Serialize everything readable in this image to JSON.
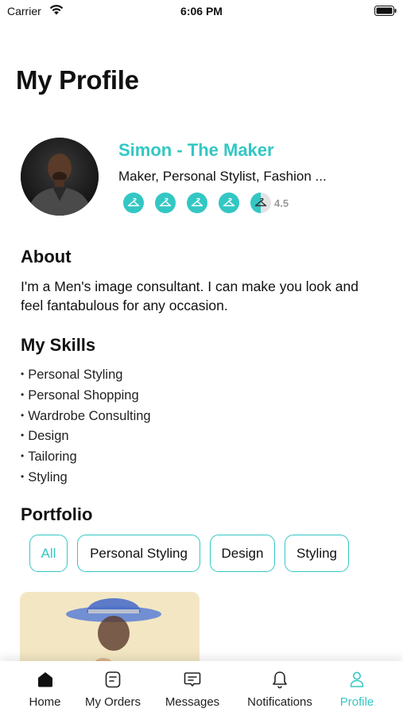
{
  "status_bar": {
    "carrier": "Carrier",
    "time": "6:06 PM"
  },
  "page_title": "My Profile",
  "profile": {
    "name": "Simon - The Maker",
    "roles": "Maker, Personal Stylist, Fashion ...",
    "rating": "4.5",
    "rating_value": 4.5,
    "rating_max": 5
  },
  "about": {
    "title": "About",
    "text": "I'm a Men's image consultant. I can make you look and feel fantabulous for any occasion."
  },
  "skills": {
    "title": "My Skills",
    "items": [
      "Personal Styling",
      "Personal Shopping",
      "Wardrobe Consulting",
      "Design",
      "Tailoring",
      "Styling"
    ]
  },
  "portfolio": {
    "title": "Portfolio",
    "filters": [
      "All",
      "Personal Styling",
      "Design",
      "Styling"
    ],
    "active_filter": "All"
  },
  "tab_bar": {
    "items": [
      {
        "label": "Home",
        "icon": "home-icon"
      },
      {
        "label": "My Orders",
        "icon": "orders-icon"
      },
      {
        "label": "Messages",
        "icon": "messages-icon"
      },
      {
        "label": "Notifications",
        "icon": "bell-icon"
      },
      {
        "label": "Profile",
        "icon": "person-icon"
      }
    ],
    "active": "Profile"
  },
  "colors": {
    "accent": "#33c7c4",
    "text": "#111111"
  }
}
